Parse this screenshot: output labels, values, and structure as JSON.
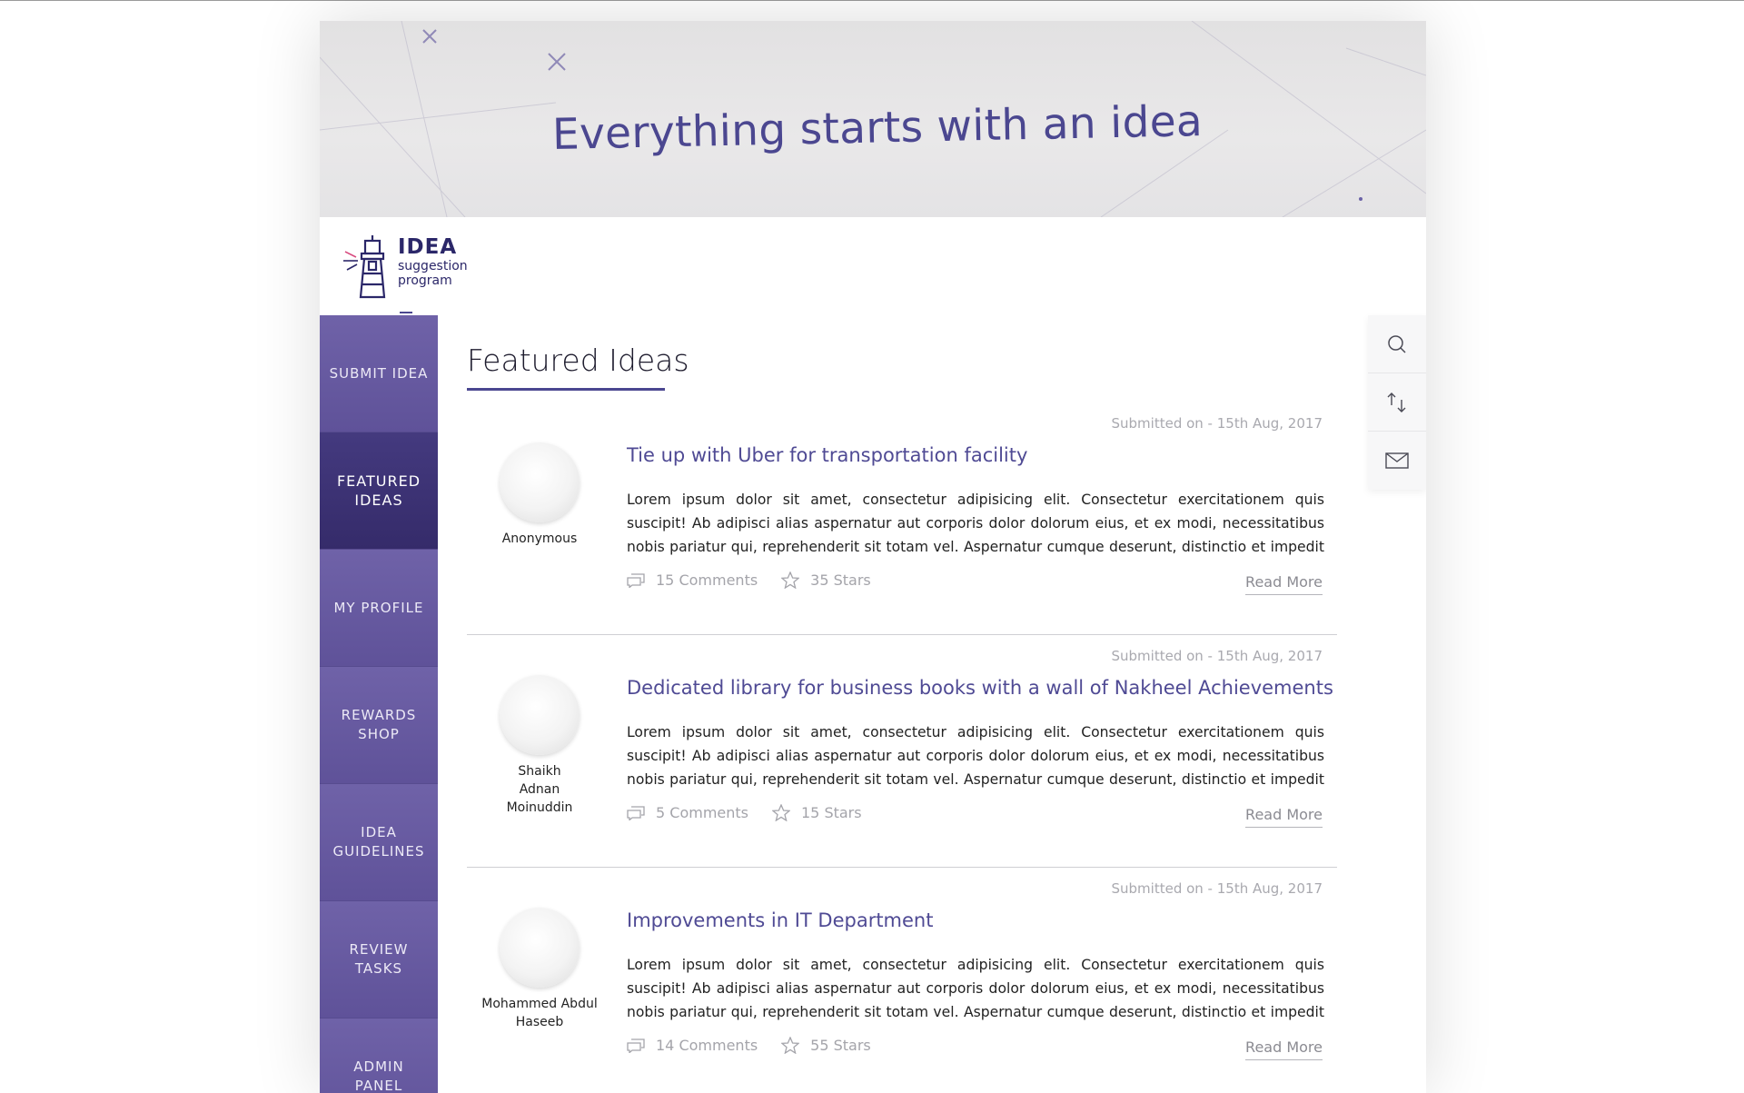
{
  "banner": {
    "title": "Everything starts with an idea"
  },
  "logo": {
    "line1": "IDEA",
    "line2": "suggestion",
    "line3": "program"
  },
  "sidebar": {
    "items": [
      {
        "label": "SUBMIT IDEA",
        "active": false
      },
      {
        "label": "FEATURED IDEAS",
        "active": true
      },
      {
        "label": "MY PROFILE",
        "active": false
      },
      {
        "label": "REWARDS SHOP",
        "active": false
      },
      {
        "label": "IDEA GUIDELINES",
        "active": false
      },
      {
        "label": "REVIEW TASKS",
        "active": false
      },
      {
        "label": "ADMIN PANEL",
        "active": false
      }
    ]
  },
  "main": {
    "title": "Featured Ideas",
    "ideas": [
      {
        "date": "Submitted on - 15th Aug, 2017",
        "author": "Anonymous",
        "title": "Tie up with Uber for transportation facility",
        "body": "Lorem ipsum dolor sit amet, consectetur adipisicing elit. Consectetur exercitationem quis suscipit! Ab adipisci alias aspernatur aut corporis dolor dolorum eius, et ex modi, necessitatibus nobis pariatur qui, reprehenderit sit totam vel. Aspernatur cumque deserunt, distinctio et impedit incidunt, labore",
        "comments": "15 Comments",
        "stars": "35 Stars",
        "read_more": "Read More"
      },
      {
        "date": "Submitted on - 15th Aug, 2017",
        "author": "Shaikh Adnan Moinuddin",
        "title": "Dedicated library for business books with a wall of Nakheel Achievements",
        "body": "Lorem ipsum dolor sit amet, consectetur adipisicing elit. Consectetur exercitationem quis suscipit! Ab adipisci alias aspernatur aut corporis dolor dolorum eius, et ex modi, necessitatibus nobis pariatur qui, reprehenderit sit totam vel. Aspernatur cumque deserunt, distinctio et impedit incidunt, labore",
        "comments": "5 Comments",
        "stars": "15 Stars",
        "read_more": "Read More"
      },
      {
        "date": "Submitted on - 15th Aug, 2017",
        "author": "Mohammed Abdul Haseeb",
        "title": "Improvements in IT Department",
        "body": "Lorem ipsum dolor sit amet, consectetur adipisicing elit. Consectetur exercitationem quis suscipit! Ab adipisci alias aspernatur aut corporis dolor dolorum eius, et ex modi, necessitatibus nobis pariatur qui, reprehenderit sit totam vel. Aspernatur cumque deserunt, distinctio et impedit incidunt, labore",
        "comments": "14 Comments",
        "stars": "55 Stars",
        "read_more": "Read More"
      }
    ]
  },
  "tools": {
    "icons": [
      "search-icon",
      "sort-icon",
      "mail-icon"
    ]
  },
  "colors": {
    "accent": "#4b4790",
    "sidebar": "#6a5ea5",
    "sidebar_active": "#3e3476"
  }
}
